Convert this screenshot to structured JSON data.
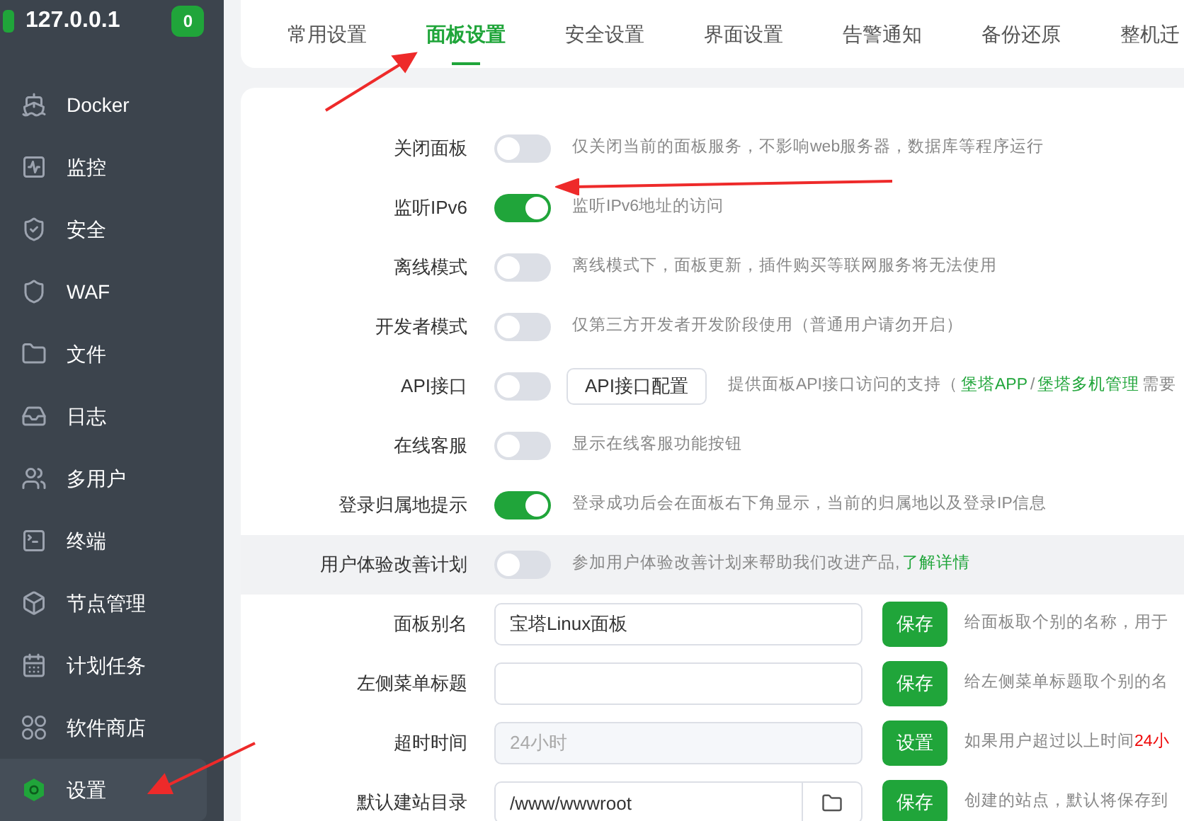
{
  "sidebar": {
    "host": "127.0.0.1",
    "badge": "0",
    "items": [
      {
        "label": "Docker",
        "selected": false
      },
      {
        "label": "监控",
        "selected": false
      },
      {
        "label": "安全",
        "selected": false
      },
      {
        "label": "WAF",
        "selected": false
      },
      {
        "label": "文件",
        "selected": false
      },
      {
        "label": "日志",
        "selected": false
      },
      {
        "label": "多用户",
        "selected": false
      },
      {
        "label": "终端",
        "selected": false
      },
      {
        "label": "节点管理",
        "selected": false
      },
      {
        "label": "计划任务",
        "selected": false
      },
      {
        "label": "软件商店",
        "selected": false
      },
      {
        "label": "设置",
        "selected": true
      }
    ]
  },
  "tabs": [
    {
      "label": "常用设置",
      "selected": false
    },
    {
      "label": "面板设置",
      "selected": true
    },
    {
      "label": "安全设置",
      "selected": false
    },
    {
      "label": "界面设置",
      "selected": false
    },
    {
      "label": "告警通知",
      "selected": false
    },
    {
      "label": "备份还原",
      "selected": false
    },
    {
      "label": "整机迁",
      "selected": false
    }
  ],
  "settings": [
    {
      "kind": "toggle",
      "label": "关闭面板",
      "on": false,
      "description": [
        {
          "kind": "text",
          "text": "仅关闭当前的面板服务，不影响web服务器，数据库等程序运行"
        }
      ]
    },
    {
      "kind": "toggle",
      "label": "监听IPv6",
      "on": true,
      "description": [
        {
          "kind": "text",
          "text": "监听IPv6地址的访问"
        }
      ]
    },
    {
      "kind": "toggle",
      "label": "离线模式",
      "on": false,
      "description": [
        {
          "kind": "text",
          "text": "离线模式下，面板更新，插件购买等联网服务将无法使用"
        }
      ]
    },
    {
      "kind": "toggle",
      "label": "开发者模式",
      "on": false,
      "description": [
        {
          "kind": "text",
          "text": "仅第三方开发者开发阶段使用（普通用户请勿开启）"
        }
      ]
    },
    {
      "kind": "toggle",
      "label": "API接口",
      "on": false,
      "button": "API接口配置",
      "description": [
        {
          "kind": "text",
          "text": "提供面板API接口访问的支持（"
        },
        {
          "kind": "link",
          "text": "堡塔APP"
        },
        {
          "kind": "text",
          "text": "/"
        },
        {
          "kind": "link",
          "text": "堡塔多机管理"
        },
        {
          "kind": "text",
          "text": "需要"
        }
      ]
    },
    {
      "kind": "toggle",
      "label": "在线客服",
      "on": false,
      "description": [
        {
          "kind": "text",
          "text": "显示在线客服功能按钮"
        }
      ]
    },
    {
      "kind": "toggle",
      "label": "登录归属地提示",
      "on": true,
      "description": [
        {
          "kind": "text",
          "text": "登录成功后会在面板右下角显示，当前的归属地以及登录IP信息"
        }
      ]
    },
    {
      "kind": "toggle",
      "label": "用户体验改善计划",
      "on": false,
      "highlighted": true,
      "description": [
        {
          "kind": "text",
          "text": "参加用户体验改善计划来帮助我们改进产品,"
        },
        {
          "kind": "link",
          "text": "了解详情"
        }
      ]
    },
    {
      "kind": "input",
      "label": "面板别名",
      "value": "宝塔Linux面板",
      "button": "保存",
      "description": [
        {
          "kind": "text",
          "text": "给面板取个别的名称，用于"
        }
      ]
    },
    {
      "kind": "input",
      "label": "左侧菜单标题",
      "button": "保存",
      "description": [
        {
          "kind": "text",
          "text": "给左侧菜单标题取个别的名"
        }
      ]
    },
    {
      "kind": "input",
      "label": "超时时间",
      "value": "24小时",
      "disabled": true,
      "button": "设置",
      "description": [
        {
          "kind": "text",
          "text": "如果用户超过以上时间"
        },
        {
          "kind": "warning",
          "text": "24小"
        }
      ]
    },
    {
      "kind": "folder",
      "label": "默认建站目录",
      "value": "/www/wwwroot",
      "button": "保存",
      "description": [
        {
          "kind": "text",
          "text": "创建的站点，默认将保存到"
        }
      ]
    }
  ]
}
